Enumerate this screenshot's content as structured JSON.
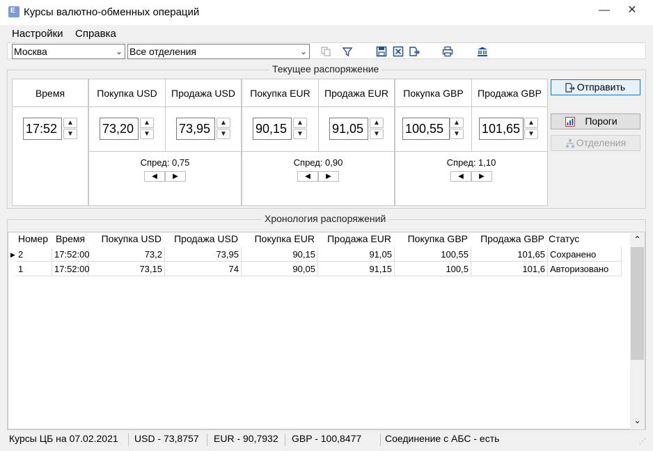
{
  "window": {
    "title": "Курсы валютно-обменных операций"
  },
  "menu": {
    "settings": "Настройки",
    "help": "Справка"
  },
  "toolbar": {
    "city": "Москва",
    "branch": "Все отделения"
  },
  "current": {
    "title": "Текущее распоряжение",
    "time_label": "Время",
    "time_value": "17:52",
    "usd_buy_label": "Покупка USD",
    "usd_sell_label": "Продажа USD",
    "usd_buy": "73,20",
    "usd_sell": "73,95",
    "usd_spread": "Спред: 0,75",
    "eur_buy_label": "Покупка EUR",
    "eur_sell_label": "Продажа EUR",
    "eur_buy": "90,15",
    "eur_sell": "91,05",
    "eur_spread": "Спред: 0,90",
    "gbp_buy_label": "Покупка GBP",
    "gbp_sell_label": "Продажа GBP",
    "gbp_buy": "100,55",
    "gbp_sell": "101,65",
    "gbp_spread": "Спред: 1,10"
  },
  "buttons": {
    "send": "Отправить",
    "thresholds": "Пороги",
    "branches": "Отделения"
  },
  "history": {
    "title": "Хронология распоряжений",
    "columns": [
      "Номер",
      "Время",
      "Покупка USD",
      "Продажа USD",
      "Покупка EUR",
      "Продажа EUR",
      "Покупка GBP",
      "Продажа GBP",
      "Статус"
    ],
    "rows": [
      [
        "2",
        "17:52:00",
        "73,2",
        "73,95",
        "90,15",
        "91,05",
        "100,55",
        "101,65",
        "Сохранено"
      ],
      [
        "1",
        "17:52:00",
        "73,15",
        "74",
        "90,05",
        "91,15",
        "100,5",
        "101,6",
        "Авторизовано"
      ]
    ]
  },
  "status": {
    "cb": "Курсы ЦБ на 07.02.2021",
    "usd": "USD - 73,8757",
    "eur": "EUR - 90,7932",
    "gbp": "GBP - 100,8477",
    "connection": "Соединение с АБС - есть"
  },
  "colors": {
    "accent": "#0078d7",
    "window_bg": "#f0f0f0",
    "panel_bg": "#ffffff"
  }
}
